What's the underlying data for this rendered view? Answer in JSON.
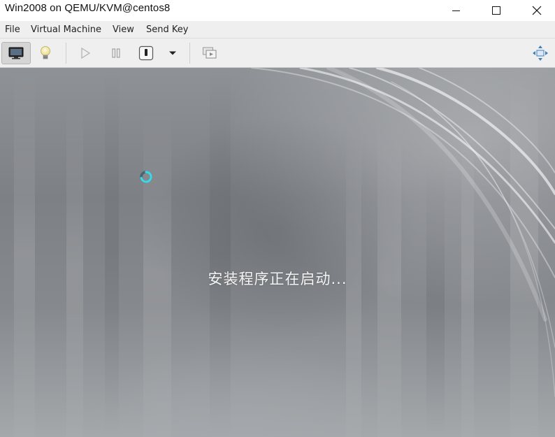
{
  "window": {
    "title": "Win2008 on QEMU/KVM@centos8"
  },
  "menubar": {
    "items": [
      "File",
      "Virtual Machine",
      "View",
      "Send Key"
    ]
  },
  "toolbar": {
    "buttons": [
      {
        "icon": "monitor-icon",
        "active": true
      },
      {
        "icon": "lightbulb-icon",
        "active": false
      },
      {
        "icon": "play-icon",
        "active": false
      },
      {
        "icon": "pause-icon",
        "active": false
      },
      {
        "icon": "power-icon",
        "active": false
      },
      {
        "icon": "dropdown-arrow-icon",
        "active": false
      },
      {
        "icon": "snapshots-icon",
        "active": false
      },
      {
        "icon": "fullscreen-icon",
        "active": false
      }
    ]
  },
  "vm_screen": {
    "boot_message": "安装程序正在启动..."
  },
  "colors": {
    "spinner_accent": "#3fd6e6",
    "menubar_bg": "#efefef"
  }
}
